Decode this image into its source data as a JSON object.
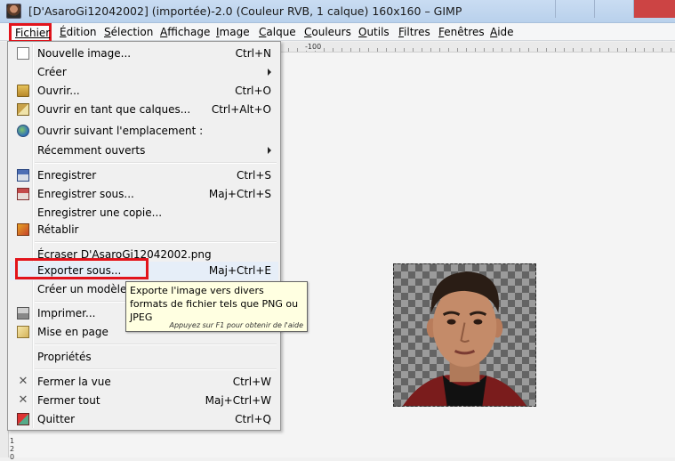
{
  "window": {
    "title": "[D'AsaroGi12042002] (importée)-2.0 (Couleur RVB, 1 calque) 160x160 – GIMP"
  },
  "menubar": {
    "items": [
      "Fichier",
      "Édition",
      "Sélection",
      "Affichage",
      "Image",
      "Calque",
      "Couleurs",
      "Outils",
      "Filtres",
      "Fenêtres",
      "Aide"
    ]
  },
  "ruler": {
    "top_label": "-100",
    "side_label_1": "1",
    "side_label_2": "2",
    "side_label_3": "0"
  },
  "file_menu": {
    "items": [
      {
        "label": "Nouvelle image...",
        "shortcut": "Ctrl+N",
        "icon": "new-document-icon"
      },
      {
        "label": "Créer",
        "shortcut": "",
        "icon": ""
      },
      {
        "label": "Ouvrir...",
        "shortcut": "Ctrl+O",
        "icon": "open-folder-icon"
      },
      {
        "label": "Ouvrir en tant que calques...",
        "shortcut": "Ctrl+Alt+O",
        "icon": "layers-icon"
      },
      {
        "label": "Ouvrir suivant l'emplacement :",
        "shortcut": "",
        "icon": "globe-icon"
      },
      {
        "label": "Récemment ouverts",
        "shortcut": "",
        "icon": ""
      },
      {
        "label": "Enregistrer",
        "shortcut": "Ctrl+S",
        "icon": "save-icon"
      },
      {
        "label": "Enregistrer sous...",
        "shortcut": "Maj+Ctrl+S",
        "icon": "save-as-icon"
      },
      {
        "label": "Enregistrer une copie...",
        "shortcut": "",
        "icon": ""
      },
      {
        "label": "Rétablir",
        "shortcut": "",
        "icon": "revert-icon"
      },
      {
        "label": "Écraser D'AsaroGi12042002.png",
        "shortcut": "",
        "icon": ""
      },
      {
        "label": "Exporter sous...",
        "shortcut": "Maj+Ctrl+E",
        "icon": ""
      },
      {
        "label": "Créer un modèle...",
        "shortcut": "",
        "icon": ""
      },
      {
        "label": "Imprimer...",
        "shortcut": "",
        "icon": "print-icon"
      },
      {
        "label": "Mise en page",
        "shortcut": "",
        "icon": "page-setup-icon"
      },
      {
        "label": "Propriétés",
        "shortcut": "",
        "icon": ""
      },
      {
        "label": "Fermer la vue",
        "shortcut": "Ctrl+W",
        "icon": "close-icon"
      },
      {
        "label": "Fermer tout",
        "shortcut": "Maj+Ctrl+W",
        "icon": "close-all-icon"
      },
      {
        "label": "Quitter",
        "shortcut": "Ctrl+Q",
        "icon": "quit-icon"
      }
    ]
  },
  "tooltip": {
    "text": "Exporte l'image vers divers formats de fichier tels que PNG ou JPEG",
    "hint": "Appuyez sur F1 pour obtenir de l'aide"
  },
  "colors": {
    "highlight": "#e2141c",
    "tooltip_bg": "#ffffe1"
  }
}
